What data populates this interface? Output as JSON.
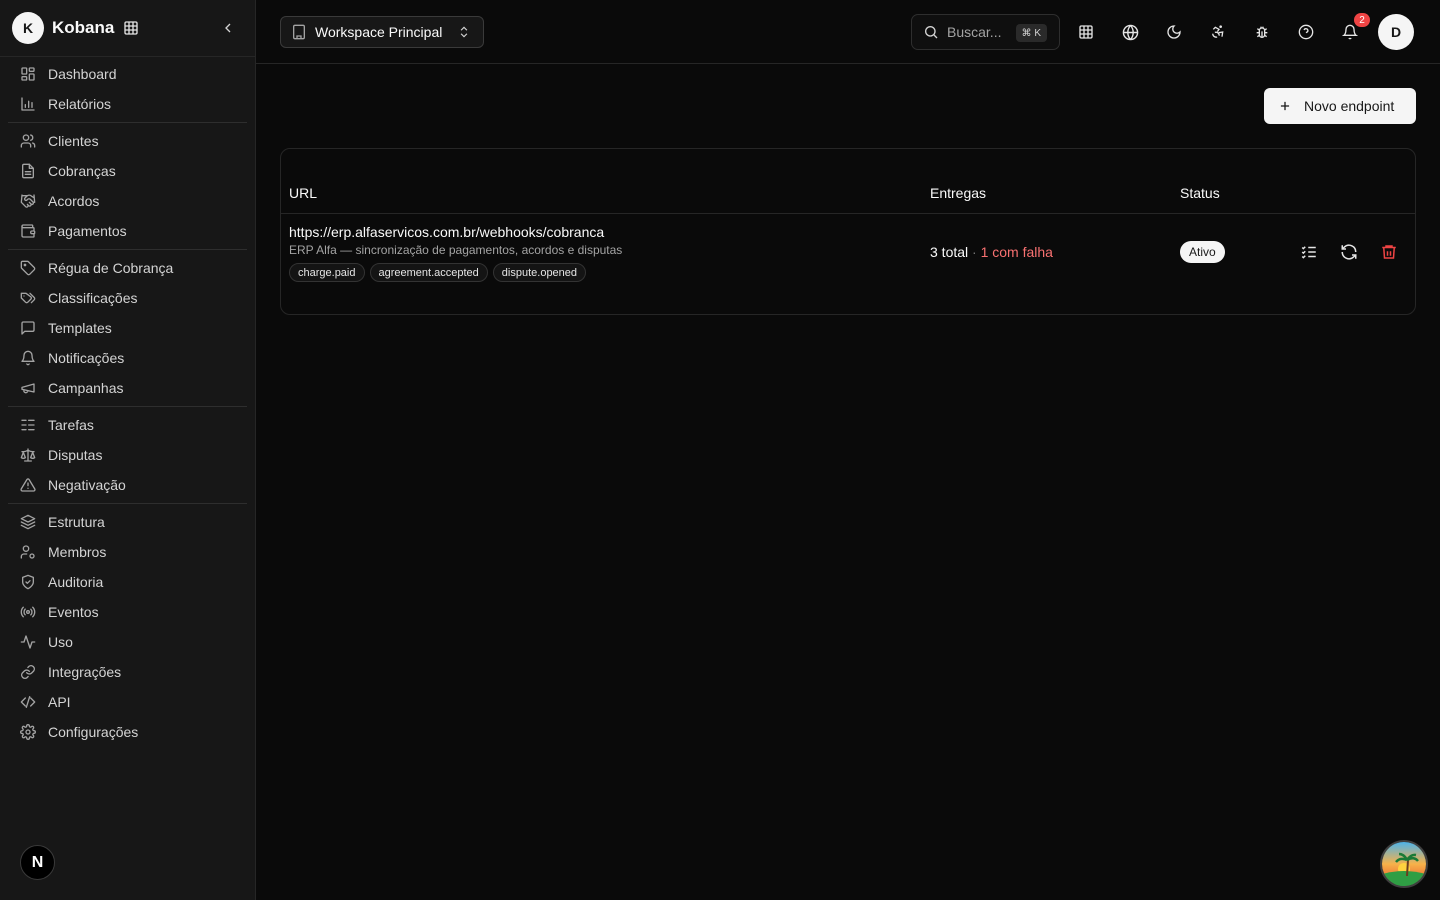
{
  "brand": {
    "initial": "K",
    "name": "Kobana"
  },
  "nav_groups": [
    [
      {
        "label": "Dashboard",
        "icon": "dashboard-icon"
      },
      {
        "label": "Relatórios",
        "icon": "bar-chart-icon"
      }
    ],
    [
      {
        "label": "Clientes",
        "icon": "users-icon"
      },
      {
        "label": "Cobranças",
        "icon": "file-icon"
      },
      {
        "label": "Acordos",
        "icon": "handshake-icon"
      },
      {
        "label": "Pagamentos",
        "icon": "wallet-icon"
      }
    ],
    [
      {
        "label": "Régua de Cobrança",
        "icon": "ruler-icon"
      },
      {
        "label": "Classificações",
        "icon": "tags-icon"
      },
      {
        "label": "Templates",
        "icon": "message-icon"
      },
      {
        "label": "Notificações",
        "icon": "bell-icon"
      },
      {
        "label": "Campanhas",
        "icon": "megaphone-icon"
      }
    ],
    [
      {
        "label": "Tarefas",
        "icon": "task-list-icon"
      },
      {
        "label": "Disputas",
        "icon": "scale-icon"
      },
      {
        "label": "Negativação",
        "icon": "warning-icon"
      }
    ],
    [
      {
        "label": "Estrutura",
        "icon": "layers-icon"
      },
      {
        "label": "Membros",
        "icon": "user-cog-icon"
      },
      {
        "label": "Auditoria",
        "icon": "shield-check-icon"
      },
      {
        "label": "Eventos",
        "icon": "radio-icon"
      },
      {
        "label": "Uso",
        "icon": "activity-icon"
      },
      {
        "label": "Integrações",
        "icon": "link-icon"
      },
      {
        "label": "API",
        "icon": "code-icon"
      },
      {
        "label": "Configurações",
        "icon": "gear-icon"
      }
    ]
  ],
  "footer_badge": "N",
  "header": {
    "workspace": "Workspace Principal",
    "search_placeholder": "Buscar...",
    "search_shortcut": "⌘ K",
    "notification_count": "2",
    "user_initial": "D"
  },
  "actions": {
    "new_endpoint": "Novo endpoint"
  },
  "table": {
    "columns": {
      "url": "URL",
      "deliveries": "Entregas",
      "status": "Status"
    },
    "rows": [
      {
        "url": "https://erp.alfaservicos.com.br/webhooks/cobranca",
        "description": "ERP Alfa — sincronização de pagamentos, acordos e disputas",
        "events": [
          "charge.paid",
          "agreement.accepted",
          "dispute.opened"
        ],
        "deliveries_total": "3 total",
        "deliveries_sep": " · ",
        "deliveries_failed": "1 com falha",
        "status": "Ativo"
      }
    ]
  },
  "colors": {
    "background": "#0a0a0a",
    "sidebar": "#171717",
    "danger": "#ef4444",
    "accent_light": "#f5f5f5"
  }
}
